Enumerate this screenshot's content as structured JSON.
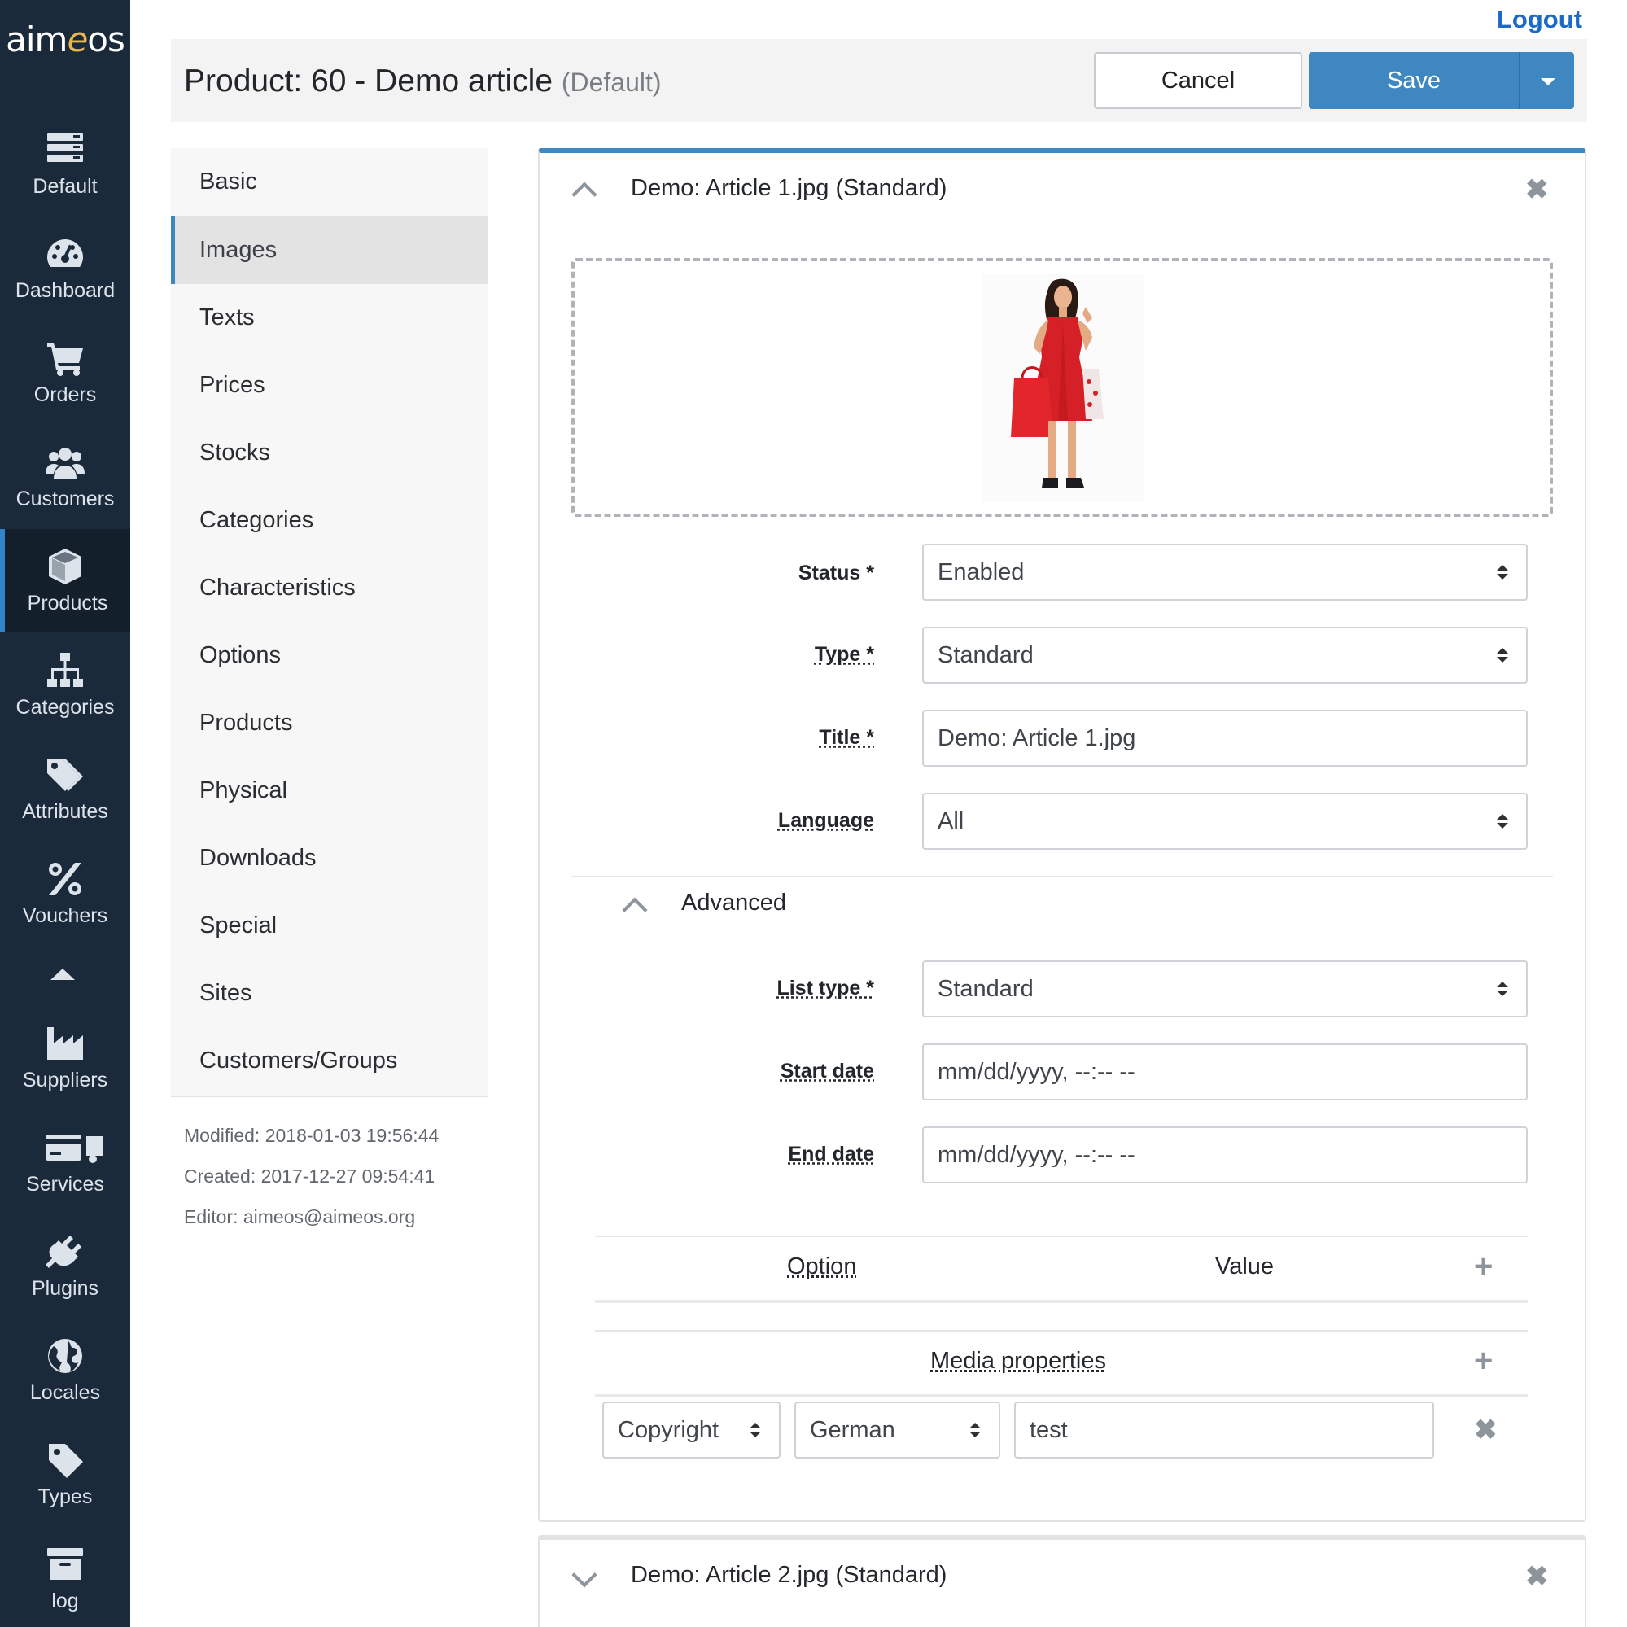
{
  "brand": {
    "logo_pre": "aim",
    "logo_accent": "e",
    "logo_post": "os"
  },
  "nav": {
    "items": [
      {
        "label": "Default",
        "icon": "server-icon"
      },
      {
        "label": "Dashboard",
        "icon": "dashboard-icon"
      },
      {
        "label": "Orders",
        "icon": "cart-icon"
      },
      {
        "label": "Customers",
        "icon": "users-icon"
      },
      {
        "label": "Products",
        "icon": "cube-icon",
        "active": true
      },
      {
        "label": "Categories",
        "icon": "sitemap-icon"
      },
      {
        "label": "Attributes",
        "icon": "tags-icon"
      },
      {
        "label": "Vouchers",
        "icon": "percent-icon"
      },
      {
        "label": "Suppliers",
        "icon": "industry-icon"
      },
      {
        "label": "Services",
        "icon": "card-truck-icon"
      },
      {
        "label": "Plugins",
        "icon": "plug-icon"
      },
      {
        "label": "Locales",
        "icon": "globe-icon"
      },
      {
        "label": "Types",
        "icon": "tag-icon"
      },
      {
        "label": "log",
        "icon": "archive-icon"
      }
    ]
  },
  "header": {
    "logout": "Logout",
    "title": "Product: 60 - Demo article",
    "site": "(Default)",
    "cancel": "Cancel",
    "save": "Save"
  },
  "tabs": [
    "Basic",
    "Images",
    "Texts",
    "Prices",
    "Stocks",
    "Categories",
    "Characteristics",
    "Options",
    "Products",
    "Physical",
    "Downloads",
    "Special",
    "Sites",
    "Customers/Groups"
  ],
  "active_tab": "Images",
  "meta": {
    "modified": "Modified: 2018-01-03 19:56:44",
    "created": "Created: 2017-12-27 09:54:41",
    "editor": "Editor: aimeos@aimeos.org"
  },
  "item1": {
    "title": "Demo: Article 1.jpg (Standard)",
    "status": {
      "label": "Status *",
      "value": "Enabled"
    },
    "type": {
      "label": "Type *",
      "value": "Standard"
    },
    "title_field": {
      "label": "Title *",
      "value": "Demo: Article 1.jpg"
    },
    "language": {
      "label": "Language",
      "value": "All"
    },
    "advanced": "Advanced",
    "list_type": {
      "label": "List type *",
      "value": "Standard"
    },
    "start_date": {
      "label": "Start date",
      "placeholder": "mm/dd/yyyy, --:-- --"
    },
    "end_date": {
      "label": "End date",
      "placeholder": "mm/dd/yyyy, --:-- --"
    },
    "config_table": {
      "col_option": "Option",
      "col_value": "Value"
    },
    "media_properties": {
      "header": "Media properties",
      "rows": [
        {
          "type": "Copyright",
          "language": "German",
          "value": "test"
        }
      ]
    }
  },
  "item2": {
    "title": "Demo: Article 2.jpg (Standard)"
  },
  "colors": {
    "accent": "#3f87c0",
    "nav_bg": "#1b2a3b",
    "logout": "#1b6ac9",
    "dress": "#d42026"
  }
}
